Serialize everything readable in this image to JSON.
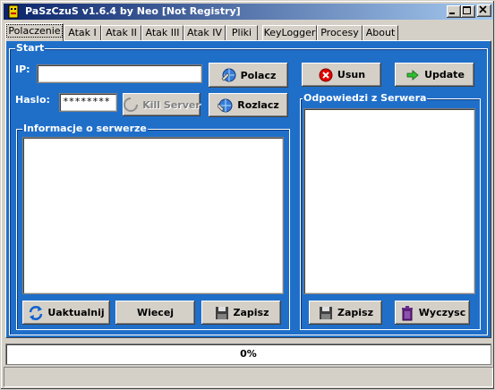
{
  "window": {
    "title": "PaSzCzuS v1.6.4 by Neo [Not Registry]"
  },
  "tabs": [
    "Polaczenie",
    "Atak I",
    "Atak II",
    "Atak III",
    "Atak IV",
    "Pliki",
    "KeyLogger",
    "Procesy",
    "About"
  ],
  "start": {
    "group_label": "Start",
    "ip_label": "IP:",
    "ip_value": "",
    "haslo_label": "Haslo:",
    "haslo_value": "********",
    "kill_label": "Kill Server",
    "polacz_label": "Polacz",
    "rozlacz_label": "Rozlacz",
    "usun_label": "Usun",
    "update_label": "Update"
  },
  "info": {
    "group_label": "Informacje o serwerze",
    "uaktualnij_label": "Uaktualnij",
    "wiecej_label": "Wiecej",
    "zapisz_label": "Zapisz"
  },
  "responses": {
    "group_label": "Odpowiedzi z Serwera",
    "zapisz_label": "Zapisz",
    "wyczysc_label": "Wyczysc"
  },
  "progress": {
    "text": "0%",
    "value": 0
  },
  "colors": {
    "panel": "#1f6fc9",
    "title_start": "#0a246a",
    "title_end": "#a6caf0"
  }
}
